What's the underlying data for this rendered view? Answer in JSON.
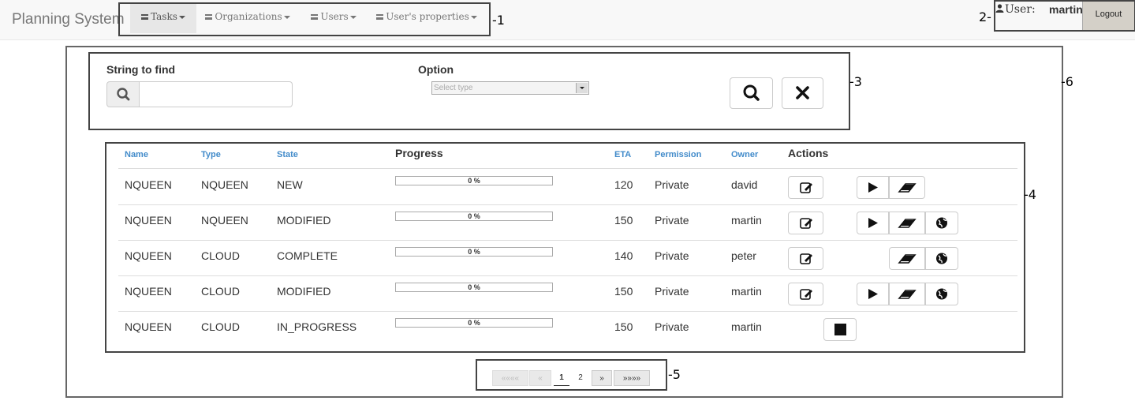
{
  "app": {
    "brand": "Planning System"
  },
  "nav": {
    "items": [
      {
        "label": "Tasks",
        "active": true
      },
      {
        "label": "Organizations",
        "active": false
      },
      {
        "label": "Users",
        "active": false
      },
      {
        "label": "User's properties",
        "active": false
      }
    ]
  },
  "user": {
    "prefix": "User:",
    "name": "martin",
    "logout_label": "Logout"
  },
  "search": {
    "string_label": "String to find",
    "string_value": "",
    "option_label": "Option",
    "option_placeholder": "Select type"
  },
  "table": {
    "columns": [
      "Name",
      "Type",
      "State",
      "Progress",
      "ETA",
      "Permission",
      "Owner",
      "Actions"
    ],
    "rows": [
      {
        "name": "NQUEEN",
        "type": "NQUEEN",
        "state": "NEW",
        "progress": "0 %",
        "progress_fraction": 0,
        "eta": "120",
        "permission": "Private",
        "owner": "david"
      },
      {
        "name": "NQUEEN",
        "type": "NQUEEN",
        "state": "MODIFIED",
        "progress": "0 %",
        "progress_fraction": 0,
        "eta": "150",
        "permission": "Private",
        "owner": "martin"
      },
      {
        "name": "NQUEEN",
        "type": "CLOUD",
        "state": "COMPLETE",
        "progress": "0 %",
        "progress_fraction": 0,
        "eta": "140",
        "permission": "Private",
        "owner": "peter"
      },
      {
        "name": "NQUEEN",
        "type": "CLOUD",
        "state": "MODIFIED",
        "progress": "0 %",
        "progress_fraction": 0,
        "eta": "150",
        "permission": "Private",
        "owner": "martin"
      },
      {
        "name": "NQUEEN",
        "type": "CLOUD",
        "state": "IN_PROGRESS",
        "progress": "0 %",
        "progress_fraction": 0,
        "eta": "150",
        "permission": "Private",
        "owner": "martin"
      }
    ]
  },
  "pagination": {
    "first": "««««",
    "prev": "«",
    "pages": [
      "1",
      "2"
    ],
    "current_page": "1",
    "next": "»",
    "last": "»»»»"
  },
  "annotations": {
    "c1": "-1",
    "c2": "2-",
    "c3": "-3",
    "c4": "-4",
    "c5": "-5",
    "c6": "-6"
  },
  "icons": {
    "menu": "menu-icon",
    "user": "user-icon",
    "search": "search-icon",
    "clear": "close-icon",
    "edit": "edit-icon",
    "play": "play-icon",
    "erase": "eraser-icon",
    "globe": "globe-icon",
    "stop": "stop-icon"
  },
  "colors": {
    "link": "#428bca",
    "navbar_bg": "#f8f8f8",
    "active_tab": "#e7e7e7"
  }
}
